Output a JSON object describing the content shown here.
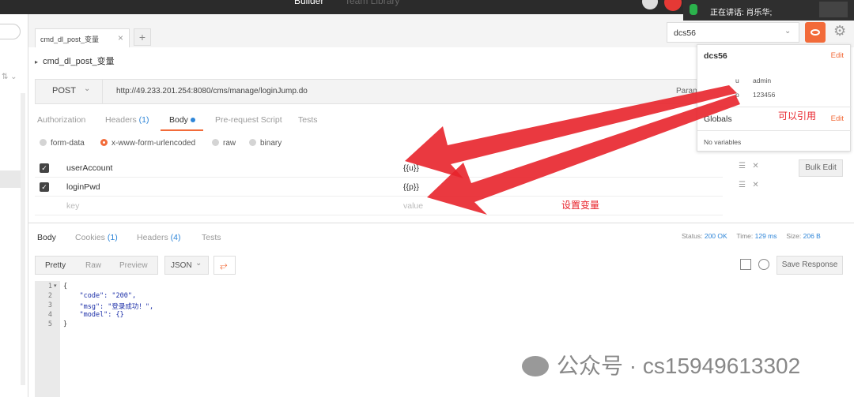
{
  "topbar": {
    "tab_builder": "Builder",
    "tab_team": "Team Library",
    "speaking": "正在讲话: 肖乐华;"
  },
  "request_tab": {
    "label": "cmd_dl_post_变量",
    "close": "×",
    "add": "+"
  },
  "request_name": "cmd_dl_post_变量",
  "environment": {
    "selected": "dcs56",
    "popover": {
      "env_name": "dcs56",
      "edit": "Edit",
      "vars": [
        {
          "key": "u",
          "value": "admin"
        },
        {
          "key": "p",
          "value": "123456"
        }
      ],
      "globals_label": "Globals",
      "globals_edit": "Edit",
      "globals_empty": "No variables"
    }
  },
  "url_bar": {
    "method": "POST",
    "url": "http://49.233.201.254:8080/cms/manage/loginJump.do",
    "params": "Params"
  },
  "request_tabs": [
    {
      "label": "Authorization"
    },
    {
      "label": "Headers",
      "count": "(1)"
    },
    {
      "label": "Body"
    },
    {
      "label": "Pre-request Script"
    },
    {
      "label": "Tests"
    }
  ],
  "body_modes": [
    "form-data",
    "x-www-form-urlencoded",
    "raw",
    "binary"
  ],
  "body_rows": [
    {
      "key": "userAccount",
      "value": "{{u}}"
    },
    {
      "key": "loginPwd",
      "value": "{{p}}"
    }
  ],
  "placeholders": {
    "key": "key",
    "value": "value"
  },
  "bulk_edit": "Bulk Edit",
  "response_tabs": [
    {
      "label": "Body"
    },
    {
      "label": "Cookies",
      "count": "(1)"
    },
    {
      "label": "Headers",
      "count": "(4)"
    },
    {
      "label": "Tests"
    }
  ],
  "status": {
    "status_label": "Status:",
    "status_value": "200 OK",
    "time_label": "Time:",
    "time_value": "129 ms",
    "size_label": "Size:",
    "size_value": "206 B"
  },
  "format_buttons": [
    "Pretty",
    "Raw",
    "Preview"
  ],
  "format_select": "JSON",
  "save_response": "Save Response",
  "code_lines": [
    {
      "n": "1",
      "text": "{"
    },
    {
      "n": "2",
      "text": "    \"code\": \"200\","
    },
    {
      "n": "3",
      "text": "    \"msg\": \"登录成功！\","
    },
    {
      "n": "4",
      "text": "    \"model\": {}"
    },
    {
      "n": "5",
      "text": "}"
    }
  ],
  "annotations": {
    "can_reference": "可以引用",
    "set_variable": "设置变量"
  },
  "watermark": "公众号 · cs15949613302",
  "colors": {
    "accent": "#f26b3a",
    "annotation": "#e8232b",
    "link_blue": "#2f86d8"
  }
}
